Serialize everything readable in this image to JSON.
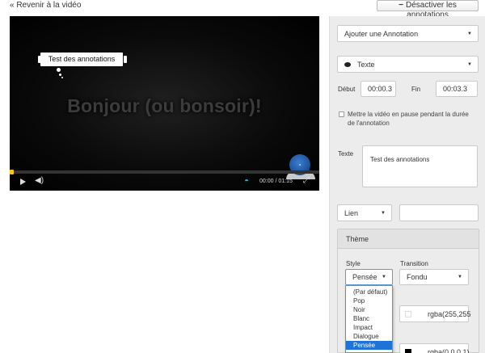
{
  "page": {
    "back_link": "« Revenir à la vidéo",
    "toggle_button": "Désactiver les annotations",
    "toggle_button_icon": "minus-icon"
  },
  "video": {
    "title_text": "Bonjour (ou bonsoir)!",
    "annotation_text": "Test des annotations",
    "time": "00:00 / 01:15",
    "progress": 0.0,
    "accent_color": "#f5c518"
  },
  "panel": {
    "add_annotation": "Ajouter une Annotation",
    "type_select": "Texte",
    "start_label": "Début",
    "start_value": "00:00.3",
    "end_label": "Fin",
    "end_value": "00:03.3",
    "pause_checkbox_label": "Mettre la vidéo en pause pendant la durée de l'annotation",
    "pause_checked": false,
    "text_label": "Texte",
    "text_value": "Test des annotations",
    "link_select": "Lien",
    "link_value": "",
    "theme_heading": "Thème",
    "style_label": "Style",
    "style_value": "Pensée",
    "transition_label": "Transition",
    "transition_value": "Fondu",
    "color1": "rgba(255,255",
    "color2": "rgba(0,0,0,1)"
  },
  "style_options": [
    "(Par défaut)",
    "Pop",
    "Noir",
    "Blanc",
    "Impact",
    "Dialogue",
    "Pensée"
  ],
  "style_selected_index": 6,
  "selection_color": "#1e73d8"
}
